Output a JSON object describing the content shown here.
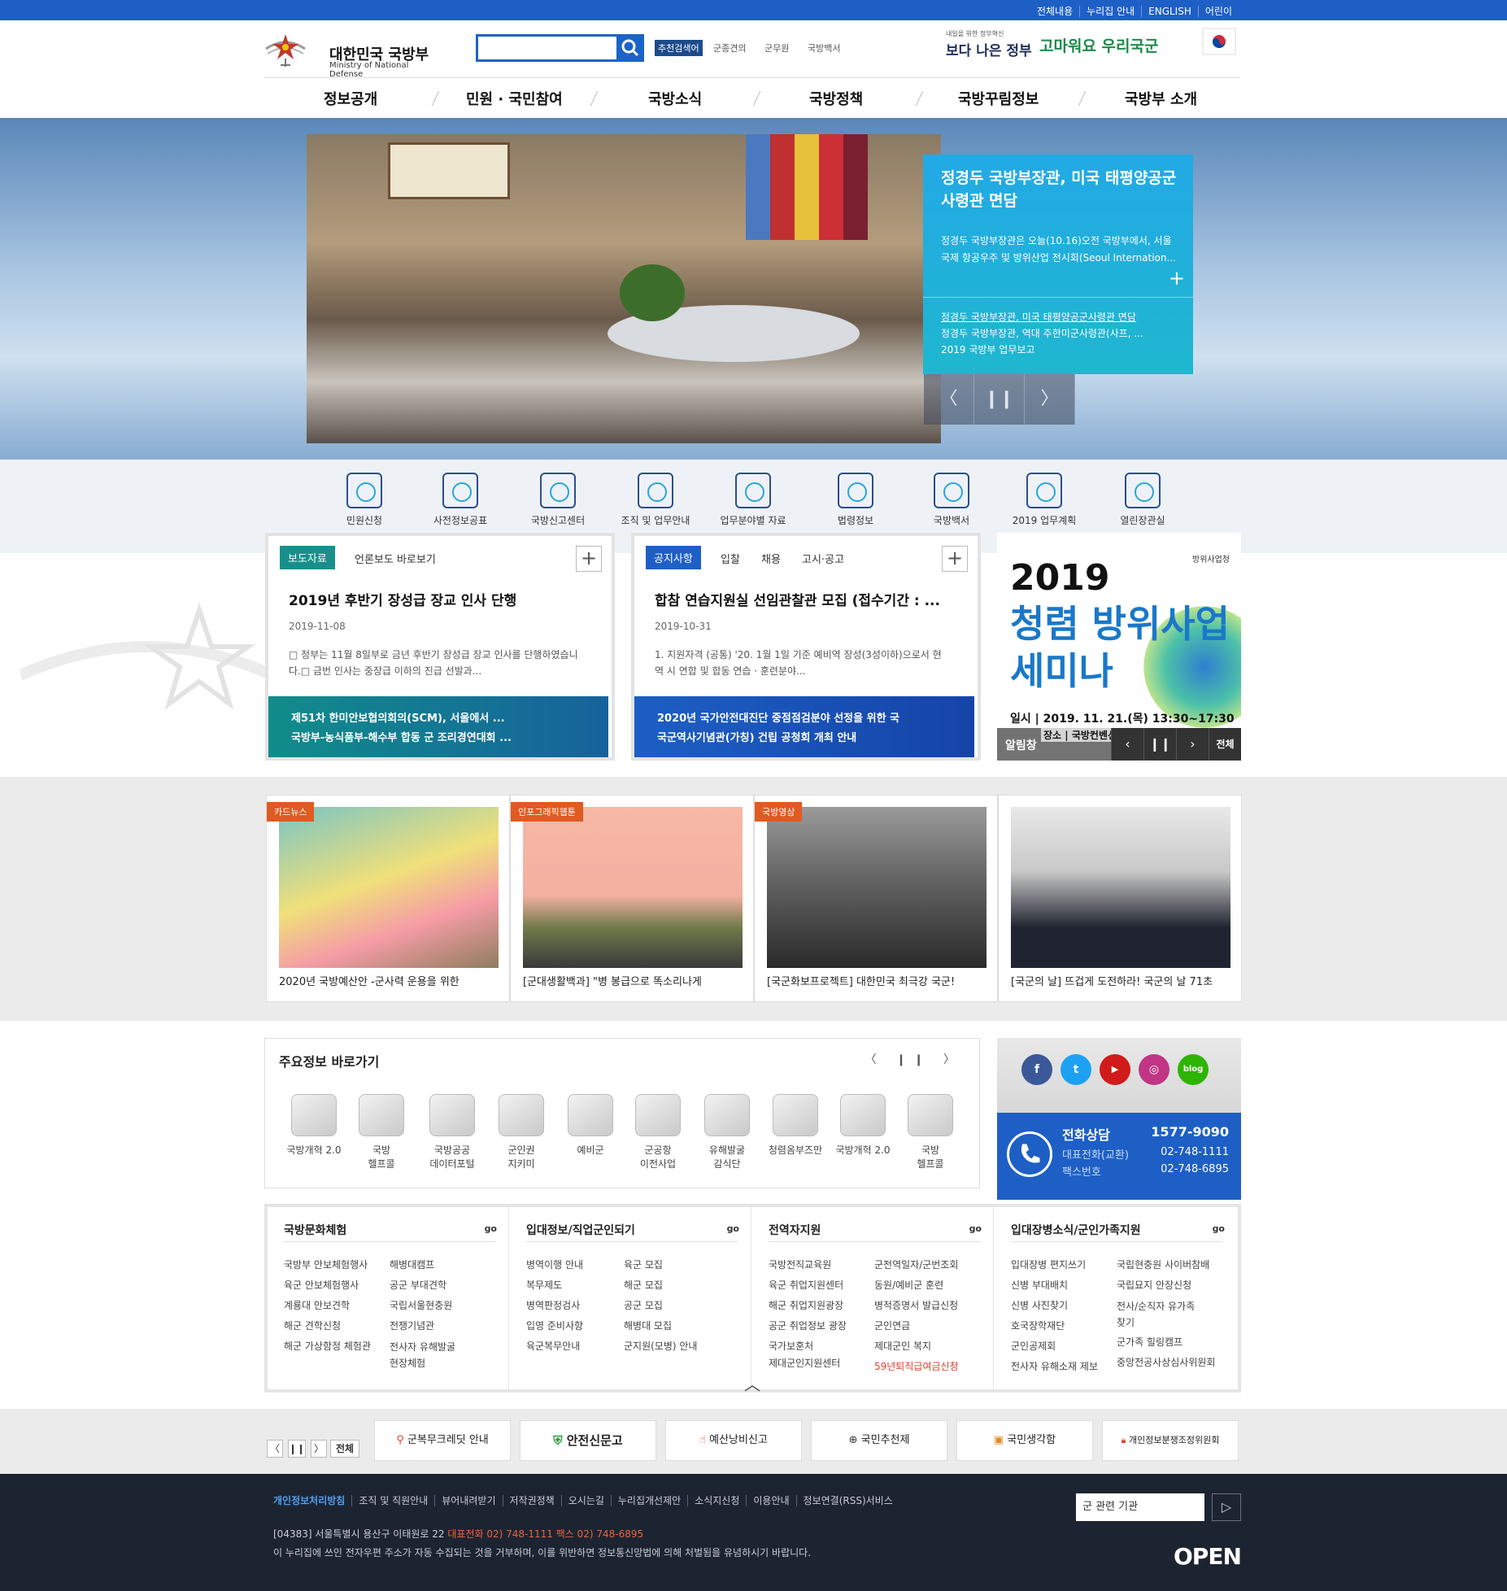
{
  "topbar": {
    "links": [
      "전체내용",
      "누리집 안내",
      "ENGLISH",
      "어린이"
    ]
  },
  "header": {
    "logo_ko": "대한민국 국방부",
    "logo_en": "Ministry of National Defense",
    "search_placeholder": "",
    "recommend": "추천검색어",
    "keywords": [
      "군종견의",
      "군무원",
      "국방백서"
    ],
    "slogan_small": "내일을 위한 정부혁신",
    "slogan_main": "보다 나은 정부",
    "slogan_right": "고마워요 우리국군"
  },
  "gnb": [
    "정보공개",
    "민원 · 국민참여",
    "국방소식",
    "국방정책",
    "국방꾸림정보",
    "국방부 소개"
  ],
  "hero": {
    "title": "정경두 국방부장관, 미국 태평양공군사령관 면담",
    "desc": "정경두 국방부장관은 오늘(10.16)오전 국방부에서, 서울 국제 항공우주 및 방위산업 전시회(Seoul Internation...",
    "items": [
      "정경두 국방부장관, 미국 태평양공군사령관 면담",
      "정경두 국방부장관, 역대 주한미군사령관(사프, ...",
      "2019 국방부 업무보고"
    ],
    "prev": "〈",
    "pause": "❙❙",
    "next": "〉"
  },
  "quick": [
    "민원신청",
    "사전정보공표",
    "국방신고센터",
    "조직 및 업무안내",
    "업무분야별 자료",
    "법령정보",
    "국방백서",
    "2019 업무계획",
    "열린장관실"
  ],
  "press": {
    "tab_on": "보도자료",
    "tab2": "언론보도 바로보기",
    "title": "2019년 후반기 장성급 장교 인사 단행",
    "date": "2019-11-08",
    "desc": "□ 정부는 11월 8일부로 금년 후반기 장성급 장교 인사를 단행하였습니다.□ 금번 인사는 중장급 이하의 진급 선발과...",
    "list": [
      "제51차 한미안보협의회의(SCM), 서울에서 ...",
      "국방부-농식품부-해수부 합동 군 조리경연대회 ..."
    ]
  },
  "noticebox": {
    "tab_on": "공지사항",
    "tabs": [
      "입찰",
      "채용",
      "고시·공고"
    ],
    "title": "합참 연습지원실 선임관찰관 모집 (접수기간 : ...",
    "date": "2019-10-31",
    "desc": "1. 지원자격 (공통) '20. 1월 1일 기준 예비역 장성(3성이하)으로서 현역 시 연합 및 합동 연습 · 훈련분야...",
    "list": [
      "2020년 국가안전대진단 중점점검분야 선정을 위한 국",
      "국군역사기념관(가칭) 건립 공청회 개최 안내"
    ]
  },
  "banner": {
    "year": "2019",
    "title1": "청렴 방위사업",
    "title2": "세미나",
    "org": "방위사업청",
    "date": "일시 | 2019. 11. 21.(목) 13:30~17:30",
    "place": "장소 | 국방컨벤션 MND Convention",
    "notice_label": "알림창",
    "all": "전체"
  },
  "cards": [
    {
      "tag": "카드뉴스",
      "caption": "2020년 국방예산안 -군사력 운용을 위한",
      "color": "#e05a22"
    },
    {
      "tag": "인포그래픽웹툰",
      "caption": "[군대생활백과] \"병 봉급으로 똑소리나게",
      "color": "#e05a22"
    },
    {
      "tag": "국방영상",
      "caption": "[국군화보프로젝트] 대한민국 최극강 국군!",
      "color": "#e05a22"
    },
    {
      "tag": "",
      "caption": "[국군의 날] 뜨겁게 도전하라! 국군의 날 71초",
      "color": "#e05a22"
    }
  ],
  "shortcuts": {
    "title": "주요정보 바로가기",
    "ctl": "〈 ❙❙ 〉",
    "items": [
      "국방개혁 2.0",
      "국방\n헬프콜",
      "국방공공\n데이터포털",
      "군인권\n지키미",
      "예비군",
      "군공항\n이전사업",
      "유해발굴\n감식단",
      "청렴옴부즈만",
      "국방개혁 2.0",
      "국방\n헬프콜"
    ]
  },
  "social": [
    "f",
    "t",
    "▶",
    "◎",
    "blog"
  ],
  "call": {
    "title": "전화상담",
    "number": "1577-9090",
    "l2": "대표전화(교환)",
    "n2": "02-748-1111",
    "l3": "팩스번호",
    "n3": "02-748-6895"
  },
  "links": [
    {
      "title": "국방문화체험",
      "go": "go",
      "items": [
        "국방부 안보체험행사",
        "해병대캠프",
        "육군 안보체험행사",
        "공군 부대견학",
        "계룡대 안보견학",
        "국립서울현충원",
        "해군 견학신청",
        "전쟁기념관",
        "해군 가상함정 체험관",
        "전사자 유해발굴\n현장체험"
      ]
    },
    {
      "title": "입대정보/직업군인되기",
      "go": "go",
      "items": [
        "병역이행 안내",
        "육군 모집",
        "복무제도",
        "해군 모집",
        "병역판정검사",
        "공군 모집",
        "입영 준비사항",
        "해병대 모집",
        "육군복무안내",
        "군지원(모병) 안내"
      ]
    },
    {
      "title": "전역자지원",
      "go": "go",
      "items": [
        "국방전직교육원",
        "군전역일자/군번조회",
        "육군 취업지원센터",
        "동원/예비군 훈련",
        "해군 취업지원광장",
        "병적증명서 발급신청",
        "공군 취업정보 광장",
        "군인연금",
        "국가보훈처",
        "제대군인 복지",
        "제대군인지원센터",
        "59년퇴직급여금신청"
      ]
    },
    {
      "title": "입대장병소식/군인가족지원",
      "go": "go",
      "items": [
        "입대장병 편지쓰기",
        "국립현충원 사이버참배",
        "신병 부대배치",
        "국립묘지 안장신청",
        "신병 사진찾기",
        "전사/순직자 유가족\n찾기",
        "호국장학재단",
        "군가족 힐링캠프",
        "군인공제회",
        "중앙전공사상심사위원회",
        "전사자 유해소재 제보"
      ]
    }
  ],
  "family": {
    "items": [
      "군복무크레딧 안내",
      "안전신문고",
      "예산낭비신고",
      "국민추천제",
      "국민생각함",
      "개인정보분쟁조정위원회"
    ],
    "prev": "〈",
    "pause": "❙❙",
    "next": "〉",
    "all": "전체"
  },
  "footer": {
    "nav": [
      "개인정보처리방침",
      "조직 및 직원안내",
      "뷰어내려받기",
      "저작권정책",
      "오시는길",
      "누리집개선제안",
      "소식지신청",
      "이용안내",
      "정보연결(RSS)서비스"
    ],
    "addr": "[04383] 서울특별시 용산구 이태원로 22",
    "tel": "대표전화 02) 748-1111 팩스 02) 748-6895",
    "copy": "이 누리집에 쓰인 전자우편 주소가 자동 수집되는 것을 거부하며, 이를 위반하면 정보통신망법에 의해 처벌됨을 유념하시기 바랍니다.",
    "select": "군 관련 기관",
    "select_btn": "▷",
    "open": "OPEN"
  }
}
